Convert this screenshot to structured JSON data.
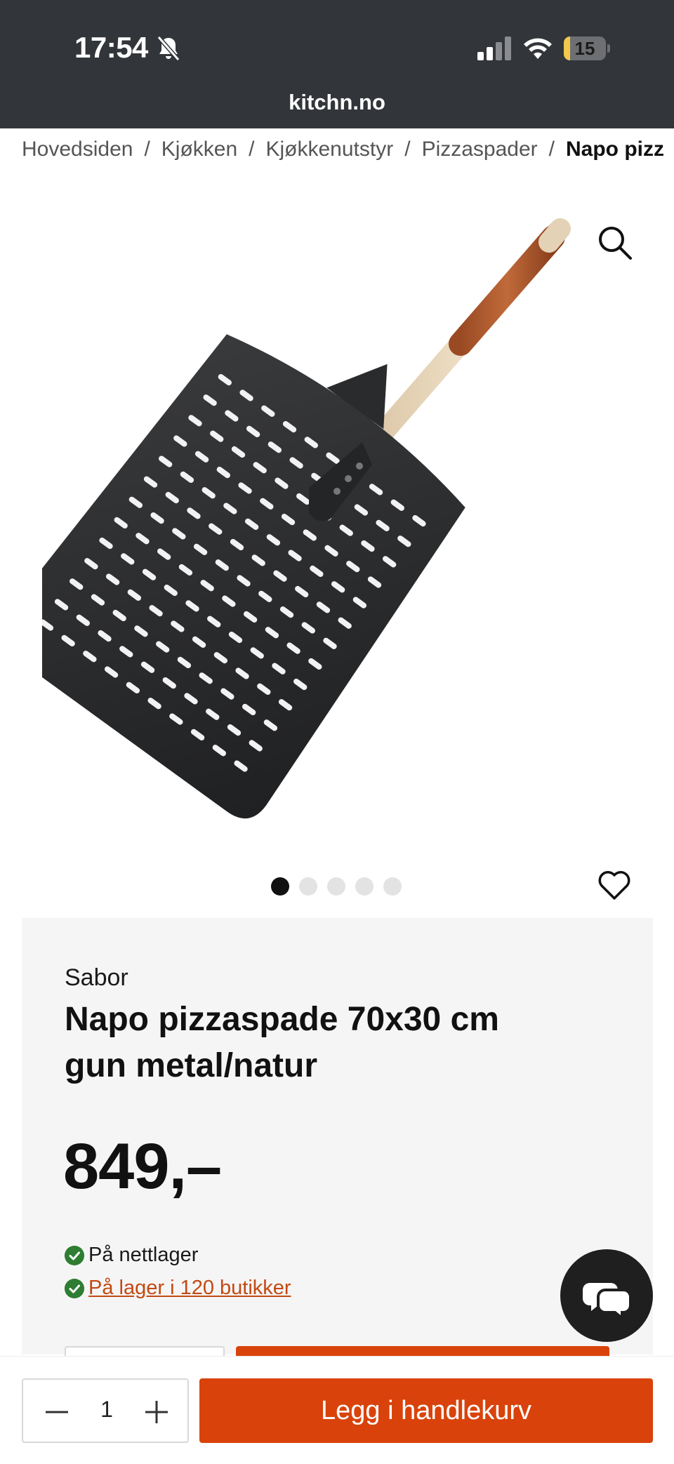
{
  "status_bar": {
    "time": "17:54",
    "battery": "15",
    "battery_percent": 15
  },
  "browser": {
    "url": "kitchn.no"
  },
  "breadcrumb": [
    {
      "label": "Hovedsiden"
    },
    {
      "label": "Kjøkken"
    },
    {
      "label": "Kjøkkenutstyr"
    },
    {
      "label": "Pizzaspader"
    },
    {
      "label": "Napo pizz"
    }
  ],
  "breadcrumb_separator": "/",
  "gallery": {
    "image_count": 5,
    "active_index": 0
  },
  "product": {
    "brand": "Sabor",
    "title": "Napo pizzaspade 70x30 cm gun metal/natur",
    "price": "849,–"
  },
  "stock": {
    "online": "På nettlager",
    "stores": "På lager i 120 butikker"
  },
  "cart": {
    "quantity": "1",
    "add_label": "Legg i handlekurv"
  },
  "colors": {
    "accent": "#d9430b",
    "topbar": "#323539",
    "panel": "#f6f5f5",
    "in_stock": "#2e7d32",
    "link": "#c24a13"
  },
  "icons": [
    "bell-slash-icon",
    "signal-icon",
    "wifi-icon",
    "battery-icon",
    "search-icon",
    "heart-icon",
    "chat-icon",
    "minus-icon",
    "plus-icon",
    "check-icon"
  ]
}
